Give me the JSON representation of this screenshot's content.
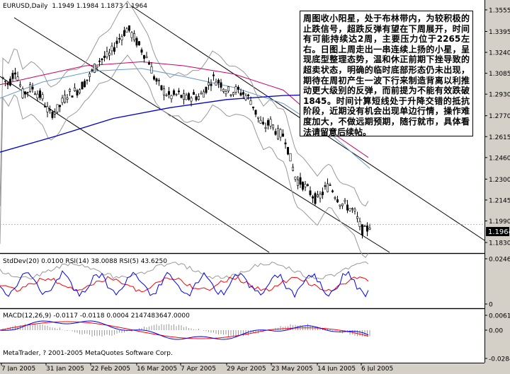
{
  "chart_data": {
    "type": "candlestick",
    "main": {
      "header": "EURUSD,Daily",
      "ohlc_label": "1.1949 1.1984 1.1873 1.1964",
      "current_price": "1.1964",
      "y_ticks": [
        "1.3555",
        "1.3395",
        "1.3240",
        "1.3085",
        "1.2930",
        "1.2770",
        "1.2615",
        "1.2460",
        "1.2300",
        "1.2145",
        "1.1990",
        "1.1830"
      ],
      "ylim": [
        1.1788,
        1.3602
      ]
    },
    "x_ticks": [
      "7 Jan 2005",
      "31 Jan 2005",
      "22 Feb 2005",
      "16 Mar 2005",
      "7 Apr 2005",
      "29 Apr 2005",
      "23 May 2005",
      "14 Jun 2005",
      "6 Jul 2005"
    ],
    "indicator1": {
      "label": "StdDev(20) 0.0100  RSI(14) 38.0088  RSI(5) 43.6250",
      "y_ticks": [
        "0.0246",
        "0"
      ]
    },
    "indicator2": {
      "label": "MACD(12,26,9) -0.0117 -0.0118 0.0004 2147483647.0000",
      "y_ticks": [
        "0.0061",
        "0.00",
        "-0.0284"
      ]
    },
    "copyright": "MetaTrader, ? 2001-2005 MetaQuotes Software Corp.",
    "colors": {
      "background": "#ffffff",
      "frame": "#d4d0c8",
      "bull": "#000000",
      "bear": "#000000",
      "ma_blue": "#0000cc",
      "ma_magenta": "#cc0066",
      "ma_light": "#6699cc",
      "rsi_red": "#ff0000",
      "rsi_blue": "#0000ff",
      "band_gray": "#999999"
    }
  },
  "annotation": {
    "text": "周图收小阳星，处于布林带内，为较积极的止跌信号，超跌反弹有望在下周展开，时间有可能持续达2周，主要压力位于2265左右。日图上周走出一串连续上扬的小星，呈现底型整理态势，温和休正前期下挫导致的超卖状态，明确的临时底部形态仍未出现，期待在周初产生一波下行来制造背离以利推动更大级别的反弹，而前提为不能有效跌破1845。时间计算短线处于升降交错的抵抗阶段，近期没有机会出现单边行情，操作难度加大，不做远期预期，随行就市，具体看法请留意后续帖。"
  }
}
